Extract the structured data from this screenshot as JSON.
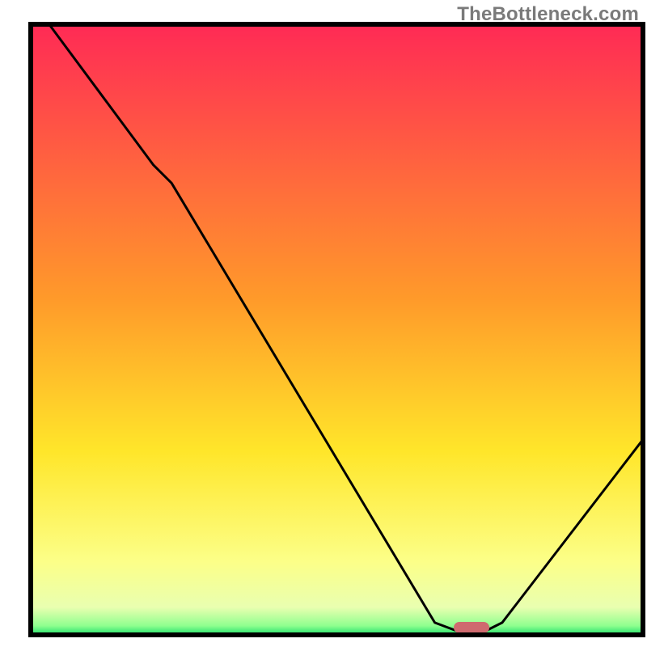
{
  "watermark": "TheBottleneck.com",
  "chart_data": {
    "type": "line",
    "title": "",
    "xlabel": "",
    "ylabel": "",
    "xlim": [
      0,
      100
    ],
    "ylim": [
      0,
      100
    ],
    "x": [
      3,
      20,
      23,
      66,
      70,
      74,
      77,
      100
    ],
    "values": [
      100,
      77,
      74,
      2,
      0.5,
      0.5,
      2,
      32
    ],
    "marker": {
      "x": 72,
      "y": 1.2,
      "color": "#cf6a6f"
    },
    "gradient_stops": [
      {
        "offset": 0.0,
        "color": "#ff2a55"
      },
      {
        "offset": 0.45,
        "color": "#ff9a2a"
      },
      {
        "offset": 0.7,
        "color": "#ffe62a"
      },
      {
        "offset": 0.88,
        "color": "#fcff88"
      },
      {
        "offset": 0.955,
        "color": "#e9ffb0"
      },
      {
        "offset": 0.985,
        "color": "#8fff8f"
      },
      {
        "offset": 1.0,
        "color": "#1fdf6a"
      }
    ],
    "frame_color": "#000000",
    "line_color": "#000000"
  }
}
